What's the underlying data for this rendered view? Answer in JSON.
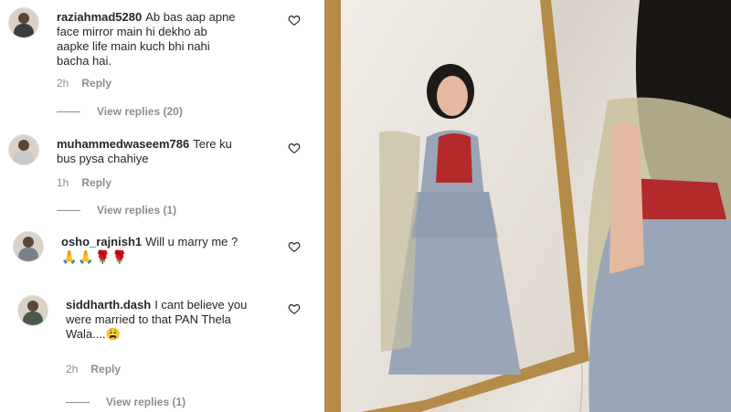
{
  "comments": [
    {
      "username": "raziahmad5280",
      "text": "Ab bas aap apne face mirror main hi dekho ab aapke life main kuch bhi nahi bacha hai.",
      "lines": [
        "Ab bas aap apne",
        "face mirror main hi dekho ab",
        "aapke life main kuch bhi nahi",
        "bacha hai."
      ],
      "time": "2h",
      "reply": "Reply",
      "view_replies": "View replies (20)"
    },
    {
      "username": "muhammedwaseem786",
      "text": "Tere ku bus pysa chahiye",
      "lines": [
        "Tere ku",
        "bus pysa chahiye"
      ],
      "time": "1h",
      "reply": "Reply",
      "view_replies": "View replies (1)"
    },
    {
      "username": "osho_rajnish1",
      "text": "Will u marry me ?",
      "emojis": "🙏🙏🌹🌹"
    },
    {
      "username": "siddharth.dash",
      "text": "I cant believe you were married to that PAN Thela Wala....😩",
      "lines": [
        "I cant believe you",
        "were married to that PAN Thela",
        "Wala....😩"
      ],
      "time": "2h",
      "reply": "Reply",
      "view_replies": "View replies (1)"
    }
  ],
  "colors": {
    "text": "#262626",
    "muted": "#8e8e8e",
    "blouse": "#b22a2a",
    "lehenga": "#9aa6b8",
    "frame": "#b48a48"
  }
}
